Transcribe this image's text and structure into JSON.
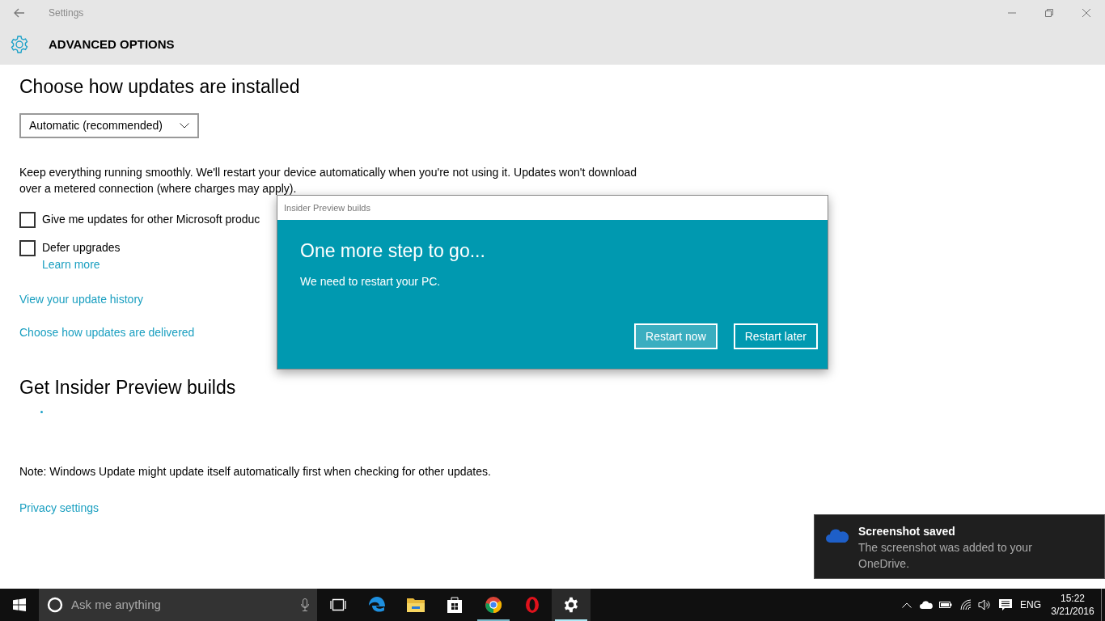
{
  "window": {
    "title": "Settings",
    "page_title": "ADVANCED OPTIONS"
  },
  "content": {
    "heading": "Choose how updates are installed",
    "dropdown": {
      "value": "Automatic (recommended)"
    },
    "description": "Keep everything running smoothly. We'll restart your device automatically when you're not using it. Updates won't download over a metered connection (where charges may apply).",
    "checkboxes": [
      {
        "label": "Give me updates for other Microsoft produc",
        "checked": false
      },
      {
        "label": "Defer upgrades",
        "checked": false,
        "link": "Learn more"
      }
    ],
    "links": [
      "View your update history",
      "Choose how updates are delivered"
    ],
    "insider_heading": "Get Insider Preview builds",
    "note": "Note: Windows Update might update itself automatically first when checking for other updates.",
    "privacy_link": "Privacy settings"
  },
  "dialog": {
    "title": "Insider Preview builds",
    "heading": "One more step to go...",
    "message": "We need to restart your PC.",
    "buttons": [
      {
        "label": "Restart now",
        "selected": true
      },
      {
        "label": "Restart later",
        "selected": false
      }
    ]
  },
  "toast": {
    "title": "Screenshot saved",
    "message": "The screenshot was added to your OneDrive."
  },
  "taskbar": {
    "search_placeholder": "Ask me anything",
    "apps": [
      {
        "kind": "taskview",
        "running": false,
        "selected": false
      },
      {
        "kind": "edge",
        "running": false,
        "selected": false
      },
      {
        "kind": "explorer",
        "running": false,
        "selected": false
      },
      {
        "kind": "store",
        "running": false,
        "selected": false
      },
      {
        "kind": "chrome",
        "running": true,
        "selected": false
      },
      {
        "kind": "opera",
        "running": false,
        "selected": false
      },
      {
        "kind": "settings",
        "running": true,
        "selected": true
      }
    ],
    "language": "ENG",
    "time": "15:22",
    "date": "3/21/2016"
  }
}
